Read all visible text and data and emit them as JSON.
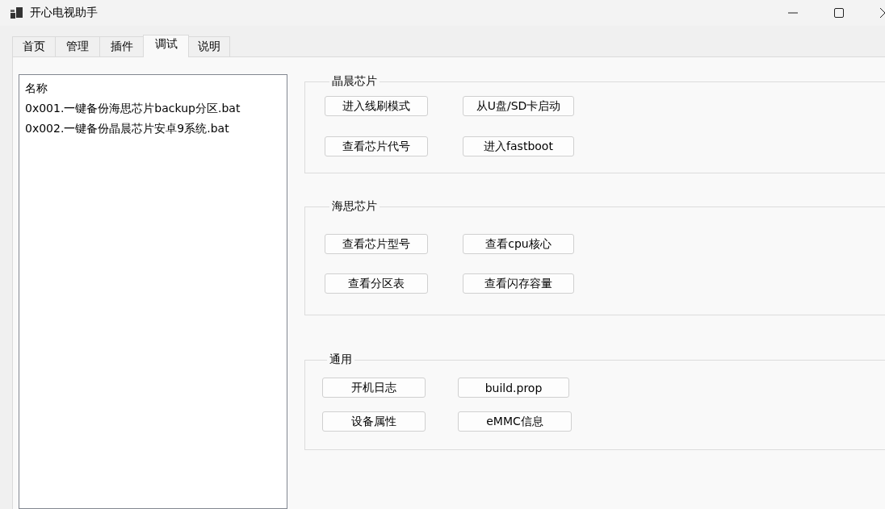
{
  "window": {
    "title": "开心电视助手"
  },
  "tabs": [
    {
      "label": "首页",
      "selected": false
    },
    {
      "label": "管理",
      "selected": false
    },
    {
      "label": "插件",
      "selected": false
    },
    {
      "label": "调试",
      "selected": true
    },
    {
      "label": "说明",
      "selected": false
    }
  ],
  "list": {
    "header": "名称",
    "items": [
      "0x001.一键备份海思芯片backup分区.bat",
      "0x002.一键备份晶晨芯片安卓9系统.bat"
    ]
  },
  "groups": [
    {
      "title": "晶晨芯片",
      "buttons": [
        "进入线刷模式",
        "从U盘/SD卡启动",
        "查看芯片代号",
        "进入fastboot"
      ]
    },
    {
      "title": "海思芯片",
      "buttons": [
        "查看芯片型号",
        "查看cpu核心",
        "查看分区表",
        "查看闪存容量"
      ]
    },
    {
      "title": "通用",
      "buttons": [
        "开机日志",
        "build.prop",
        "设备属性",
        "eMMC信息"
      ]
    }
  ]
}
